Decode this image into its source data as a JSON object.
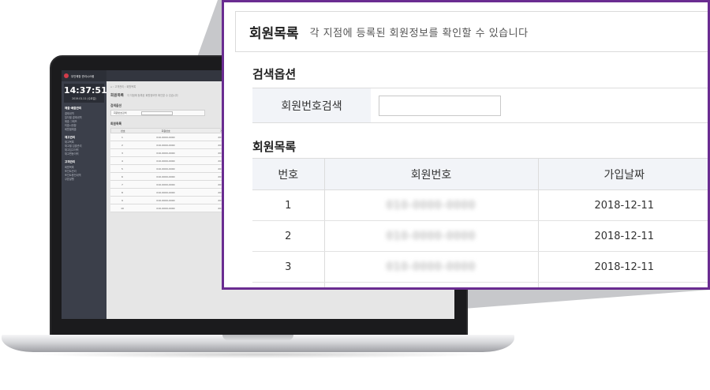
{
  "laptop_screen": {
    "brand": "무인매장 관리시스템",
    "clock": "14:37:51",
    "date": "2019.01.11 (수요일)",
    "sidebar_groups": [
      {
        "title": "매출·배출관리",
        "items": [
          "결제내역",
          "일자별 결제내역",
          "매출 그래프",
          "미출시현황",
          "회원별매출"
        ]
      },
      {
        "title": "재고관리",
        "items": [
          "재고목록",
          "재고별 입출관리",
          "재고입고이력",
          "재고변동이력"
        ]
      },
      {
        "title": "고객관리",
        "items": [
          "회원목록",
          "포인트관리",
          "포인트충전내역",
          "쿠폰발행"
        ]
      }
    ],
    "breadcrumb": "⌂ › 고객관리 › 회원목록",
    "page_title": "회원목록",
    "page_subtitle": "각 지점에 등록된 회원정보를 확인할 수 있습니다",
    "search_section": "검색옵션",
    "search_label": "회원번호검색",
    "list_section": "회원목록",
    "headers": [
      "번호",
      "회원번호",
      "가입날짜"
    ],
    "rows": [
      [
        "1",
        "010-0000-0000",
        "2018-12-11"
      ],
      [
        "2",
        "010-0000-0000",
        "2018-12-11"
      ],
      [
        "3",
        "010-0000-0000",
        "2018-12-11"
      ],
      [
        "4",
        "010-0000-0000",
        "2018-12-11"
      ],
      [
        "5",
        "010-0000-0000",
        "2018-12-11"
      ],
      [
        "6",
        "010-0000-0000",
        "2018-12-11"
      ],
      [
        "7",
        "010-0000-0000",
        "2018-12-11"
      ],
      [
        "8",
        "010-0000-0000",
        "2018-12-11"
      ],
      [
        "9",
        "010-0000-0000",
        "2018-12-11"
      ],
      [
        "10",
        "010-0000-0000",
        "2018-12-11"
      ]
    ]
  },
  "zoom": {
    "title": "회원목록",
    "subtitle": "각 지점에 등록된 회원정보를 확인할 수 있습니다",
    "search_section": "검색옵션",
    "search_label": "회원번호검색",
    "search_value": "",
    "list_section": "회원목록",
    "headers": {
      "no": "번호",
      "member": "회원번호",
      "date": "가입날짜"
    },
    "rows": [
      {
        "no": "1",
        "member": "010-0000-0000",
        "date": "2018-12-11"
      },
      {
        "no": "2",
        "member": "010-0000-0000",
        "date": "2018-12-11"
      },
      {
        "no": "3",
        "member": "010-0000-0000",
        "date": "2018-12-11"
      }
    ]
  },
  "colors": {
    "zoom_border": "#6a2c91",
    "sidebar_bg": "#3b3f4a",
    "header_bg": "#f2f4f8",
    "projection": "#c7c8cb"
  }
}
